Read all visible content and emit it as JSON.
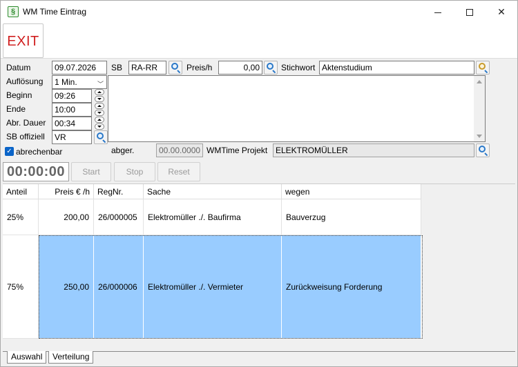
{
  "window": {
    "title": "WM Time Eintrag",
    "icon": "section-sign-icon"
  },
  "toolbar": {
    "exit_label": "EXIT"
  },
  "form": {
    "datum_label": "Datum",
    "datum_value": "09.07.2026",
    "aufloesung_label": "Auflösung",
    "aufloesung_value": "1 Min.",
    "beginn_label": "Beginn",
    "beginn_value": "09:26",
    "ende_label": "Ende",
    "ende_value": "10:00",
    "abr_dauer_label": "Abr. Dauer",
    "abr_dauer_value": "00:34",
    "sb_offiziell_label": "SB offiziell",
    "sb_offiziell_value": "VR",
    "sb_label": "SB",
    "sb_value": "RA-RR",
    "preis_label": "Preis/h",
    "preis_value": "0,00",
    "stichwort_label": "Stichwort",
    "stichwort_value": "Aktenstudium",
    "abrechenbar_label": "abrechenbar",
    "abrechenbar_checked": true,
    "abger_label": "abger.",
    "abger_value": "00.00.0000",
    "projekt_label": "WMTime Projekt",
    "projekt_value": "ELEKTROMÜLLER",
    "memo_value": ""
  },
  "timer": {
    "display": "00:00:00",
    "start_label": "Start",
    "stop_label": "Stop",
    "reset_label": "Reset"
  },
  "grid": {
    "columns": [
      "Anteil",
      "Preis € /h",
      "RegNr.",
      "Sache",
      "wegen"
    ],
    "rows": [
      {
        "anteil": "25%",
        "preis": "200,00",
        "regnr": "26/000005",
        "sache": "Elektromüller ./. Baufirma",
        "wegen": "Bauverzug",
        "selected": false
      },
      {
        "anteil": "75%",
        "preis": "250,00",
        "regnr": "26/000006",
        "sache": "Elektromüller ./. Vermieter",
        "wegen": "Zurückweisung Forderung",
        "selected": true
      }
    ]
  },
  "tabs": [
    "Auswahl",
    "Verteilung"
  ],
  "colors": {
    "exit_text": "#d01f1f",
    "selection": "#99ccff",
    "checkbox": "#0a64c8"
  }
}
